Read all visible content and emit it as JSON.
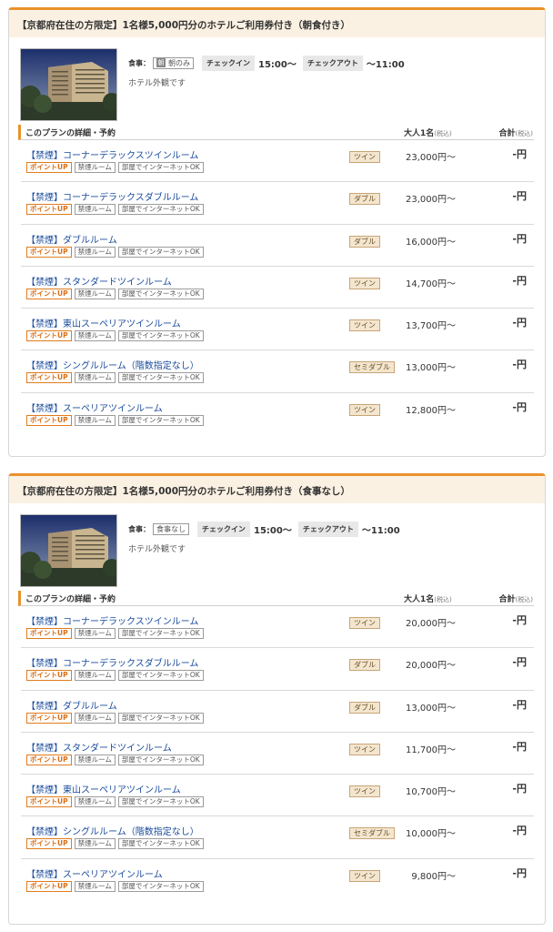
{
  "plans": [
    {
      "title": "【京都府在住の方限定】1名様5,000円分のホテルご利用券付き（朝食付き）",
      "meal_label": "食事：",
      "meal_icon": "朝",
      "meal_value": "朝のみ",
      "checkin_label": "チェックイン",
      "checkin_time": "15:00～",
      "checkout_label": "チェックアウト",
      "checkout_time": "～11:00",
      "photo_caption": "ホテル外観です",
      "detail_title": "このプランの詳細・予約",
      "price_header": "大人1名",
      "price_header_tax": "(税込)",
      "total_header": "合計",
      "total_header_tax": "(税込)",
      "rooms": [
        {
          "name": "【禁煙】コーナーデラックスツインルーム",
          "tags": [
            "ポイントUP",
            "禁煙ルーム",
            "部屋でインターネットOK"
          ],
          "bed": "ツイン",
          "price": "23,000円～",
          "total": "-円"
        },
        {
          "name": "【禁煙】コーナーデラックスダブルルーム",
          "tags": [
            "ポイントUP",
            "禁煙ルーム",
            "部屋でインターネットOK"
          ],
          "bed": "ダブル",
          "price": "23,000円～",
          "total": "-円"
        },
        {
          "name": "【禁煙】ダブルルーム",
          "tags": [
            "ポイントUP",
            "禁煙ルーム",
            "部屋でインターネットOK"
          ],
          "bed": "ダブル",
          "price": "16,000円～",
          "total": "-円"
        },
        {
          "name": "【禁煙】スタンダードツインルーム",
          "tags": [
            "ポイントUP",
            "禁煙ルーム",
            "部屋でインターネットOK"
          ],
          "bed": "ツイン",
          "price": "14,700円～",
          "total": "-円"
        },
        {
          "name": "【禁煙】東山スーペリアツインルーム",
          "tags": [
            "ポイントUP",
            "禁煙ルーム",
            "部屋でインターネットOK"
          ],
          "bed": "ツイン",
          "price": "13,700円～",
          "total": "-円"
        },
        {
          "name": "【禁煙】シングルルーム（階数指定なし）",
          "tags": [
            "ポイントUP",
            "禁煙ルーム",
            "部屋でインターネットOK"
          ],
          "bed": "セミダブル",
          "price": "13,000円～",
          "total": "-円"
        },
        {
          "name": "【禁煙】スーペリアツインルーム",
          "tags": [
            "ポイントUP",
            "禁煙ルーム",
            "部屋でインターネットOK"
          ],
          "bed": "ツイン",
          "price": "12,800円～",
          "total": "-円"
        }
      ]
    },
    {
      "title": "【京都府在住の方限定】1名様5,000円分のホテルご利用券付き（食事なし）",
      "meal_label": "食事：",
      "meal_icon": "",
      "meal_value": "食事なし",
      "checkin_label": "チェックイン",
      "checkin_time": "15:00～",
      "checkout_label": "チェックアウト",
      "checkout_time": "～11:00",
      "photo_caption": "ホテル外観です",
      "detail_title": "このプランの詳細・予約",
      "price_header": "大人1名",
      "price_header_tax": "(税込)",
      "total_header": "合計",
      "total_header_tax": "(税込)",
      "rooms": [
        {
          "name": "【禁煙】コーナーデラックスツインルーム",
          "tags": [
            "ポイントUP",
            "禁煙ルーム",
            "部屋でインターネットOK"
          ],
          "bed": "ツイン",
          "price": "20,000円～",
          "total": "-円"
        },
        {
          "name": "【禁煙】コーナーデラックスダブルルーム",
          "tags": [
            "ポイントUP",
            "禁煙ルーム",
            "部屋でインターネットOK"
          ],
          "bed": "ダブル",
          "price": "20,000円～",
          "total": "-円"
        },
        {
          "name": "【禁煙】ダブルルーム",
          "tags": [
            "ポイントUP",
            "禁煙ルーム",
            "部屋でインターネットOK"
          ],
          "bed": "ダブル",
          "price": "13,000円～",
          "total": "-円"
        },
        {
          "name": "【禁煙】スタンダードツインルーム",
          "tags": [
            "ポイントUP",
            "禁煙ルーム",
            "部屋でインターネットOK"
          ],
          "bed": "ツイン",
          "price": "11,700円～",
          "total": "-円"
        },
        {
          "name": "【禁煙】東山スーペリアツインルーム",
          "tags": [
            "ポイントUP",
            "禁煙ルーム",
            "部屋でインターネットOK"
          ],
          "bed": "ツイン",
          "price": "10,700円～",
          "total": "-円"
        },
        {
          "name": "【禁煙】シングルルーム（階数指定なし）",
          "tags": [
            "ポイントUP",
            "禁煙ルーム",
            "部屋でインターネットOK"
          ],
          "bed": "セミダブル",
          "price": "10,000円～",
          "total": "-円"
        },
        {
          "name": "【禁煙】スーペリアツインルーム",
          "tags": [
            "ポイントUP",
            "禁煙ルーム",
            "部屋でインターネットOK"
          ],
          "bed": "ツイン",
          "price": "9,800円～",
          "total": "-円"
        }
      ]
    }
  ],
  "colors": {
    "accent": "#e8922b",
    "header_bg": "#fbf1e3",
    "link": "#1a4b9c",
    "point_tag": "#d8701a",
    "bed_badge_bg": "#f3e6cf"
  }
}
